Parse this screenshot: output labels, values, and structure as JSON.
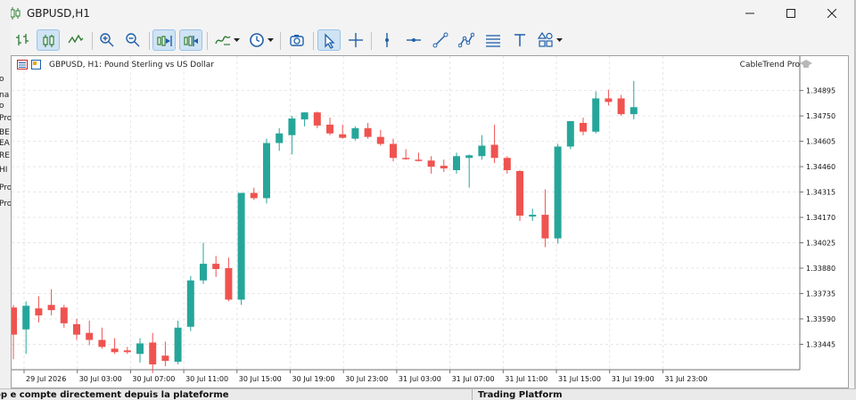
{
  "window": {
    "title": "GBPUSD,H1"
  },
  "toolbar": {
    "icons": [
      "bar-chart-icon",
      "candlestick-icon",
      "line-chart-icon",
      "zoom-in-icon",
      "zoom-out-icon",
      "autoscroll-icon",
      "chart-shift-icon",
      "indicators-icon",
      "timeframes-icon",
      "screenshot-icon",
      "cursor-icon",
      "crosshair-icon",
      "vertical-line-icon",
      "horizontal-line-icon",
      "trendline-icon",
      "objects-icon",
      "channels-icon",
      "text-icon",
      "shapes-icon"
    ]
  },
  "chart": {
    "header": "GBPUSD, H1:  Pound Sterling vs US Dollar",
    "expert_label": "CableTrend Pro",
    "bull_color": "#26a69a",
    "bear_color": "#ef5350",
    "grid_color": "#e6e6e6"
  },
  "chart_data": {
    "type": "candlestick",
    "symbol": "GBPUSD",
    "timeframe": "H1",
    "y_ticks": [
      "1.34895",
      "1.34750",
      "1.34605",
      "1.34460",
      "1.34315",
      "1.34170",
      "1.34025",
      "1.33880",
      "1.33735",
      "1.33590",
      "1.33445"
    ],
    "x_ticks": [
      "29 Jul 2026",
      "30 Jul 03:00",
      "30 Jul 07:00",
      "30 Jul 11:00",
      "30 Jul 15:00",
      "30 Jul 19:00",
      "30 Jul 23:00",
      "31 Jul 03:00",
      "31 Jul 07:00",
      "31 Jul 11:00",
      "31 Jul 15:00",
      "31 Jul 19:00",
      "31 Jul 23:00"
    ],
    "ylim": [
      1.3332,
      1.35
    ],
    "candles": [
      {
        "o": 1.33655,
        "h": 1.3367,
        "l": 1.3336,
        "c": 1.335
      },
      {
        "o": 1.3353,
        "h": 1.3369,
        "l": 1.3339,
        "c": 1.33665
      },
      {
        "o": 1.3365,
        "h": 1.3372,
        "l": 1.3357,
        "c": 1.3361
      },
      {
        "o": 1.3367,
        "h": 1.3376,
        "l": 1.3361,
        "c": 1.3364
      },
      {
        "o": 1.33655,
        "h": 1.3367,
        "l": 1.3354,
        "c": 1.33565
      },
      {
        "o": 1.3356,
        "h": 1.3359,
        "l": 1.3347,
        "c": 1.335
      },
      {
        "o": 1.3351,
        "h": 1.3358,
        "l": 1.3344,
        "c": 1.3347
      },
      {
        "o": 1.3347,
        "h": 1.3354,
        "l": 1.3342,
        "c": 1.3343
      },
      {
        "o": 1.3342,
        "h": 1.3348,
        "l": 1.3339,
        "c": 1.334
      },
      {
        "o": 1.3341,
        "h": 1.3343,
        "l": 1.3339,
        "c": 1.334
      },
      {
        "o": 1.3339,
        "h": 1.3348,
        "l": 1.3334,
        "c": 1.3345
      },
      {
        "o": 1.33455,
        "h": 1.3351,
        "l": 1.3328,
        "c": 1.3333
      },
      {
        "o": 1.3338,
        "h": 1.3346,
        "l": 1.3332,
        "c": 1.3335
      },
      {
        "o": 1.33345,
        "h": 1.3358,
        "l": 1.3333,
        "c": 1.3354
      },
      {
        "o": 1.33545,
        "h": 1.33835,
        "l": 1.3352,
        "c": 1.3381
      },
      {
        "o": 1.3381,
        "h": 1.34025,
        "l": 1.3379,
        "c": 1.33905
      },
      {
        "o": 1.33905,
        "h": 1.3395,
        "l": 1.3383,
        "c": 1.33875
      },
      {
        "o": 1.3388,
        "h": 1.3394,
        "l": 1.3369,
        "c": 1.337
      },
      {
        "o": 1.337,
        "h": 1.34005,
        "l": 1.3367,
        "c": 1.3431
      },
      {
        "o": 1.3431,
        "h": 1.3434,
        "l": 1.3427,
        "c": 1.3428
      },
      {
        "o": 1.3428,
        "h": 1.3462,
        "l": 1.3425,
        "c": 1.34595
      },
      {
        "o": 1.34595,
        "h": 1.3468,
        "l": 1.3455,
        "c": 1.3465
      },
      {
        "o": 1.3464,
        "h": 1.3475,
        "l": 1.3453,
        "c": 1.34735
      },
      {
        "o": 1.3473,
        "h": 1.3477,
        "l": 1.3469,
        "c": 1.3477
      },
      {
        "o": 1.3477,
        "h": 1.34775,
        "l": 1.3468,
        "c": 1.34695
      },
      {
        "o": 1.347,
        "h": 1.3474,
        "l": 1.3464,
        "c": 1.3465
      },
      {
        "o": 1.34645,
        "h": 1.347,
        "l": 1.3462,
        "c": 1.34625
      },
      {
        "o": 1.3462,
        "h": 1.3469,
        "l": 1.3461,
        "c": 1.3468
      },
      {
        "o": 1.3468,
        "h": 1.3471,
        "l": 1.3462,
        "c": 1.3463
      },
      {
        "o": 1.3463,
        "h": 1.3467,
        "l": 1.3458,
        "c": 1.3459
      },
      {
        "o": 1.3459,
        "h": 1.3462,
        "l": 1.3449,
        "c": 1.3451
      },
      {
        "o": 1.3451,
        "h": 1.3456,
        "l": 1.345,
        "c": 1.34505
      },
      {
        "o": 1.345,
        "h": 1.3454,
        "l": 1.3449,
        "c": 1.34495
      },
      {
        "o": 1.34495,
        "h": 1.3452,
        "l": 1.3442,
        "c": 1.3446
      },
      {
        "o": 1.34465,
        "h": 1.345,
        "l": 1.3443,
        "c": 1.3445
      },
      {
        "o": 1.3444,
        "h": 1.3454,
        "l": 1.3442,
        "c": 1.3452
      },
      {
        "o": 1.3451,
        "h": 1.3453,
        "l": 1.3434,
        "c": 1.34525
      },
      {
        "o": 1.3452,
        "h": 1.3464,
        "l": 1.345,
        "c": 1.3458
      },
      {
        "o": 1.34585,
        "h": 1.347,
        "l": 1.3448,
        "c": 1.3451
      },
      {
        "o": 1.3451,
        "h": 1.3452,
        "l": 1.3442,
        "c": 1.3444
      },
      {
        "o": 1.34435,
        "h": 1.3444,
        "l": 1.3415,
        "c": 1.3418
      },
      {
        "o": 1.34175,
        "h": 1.3422,
        "l": 1.3415,
        "c": 1.34185
      },
      {
        "o": 1.34185,
        "h": 1.3433,
        "l": 1.34,
        "c": 1.3405
      },
      {
        "o": 1.3405,
        "h": 1.3459,
        "l": 1.3402,
        "c": 1.34575
      },
      {
        "o": 1.34575,
        "h": 1.3472,
        "l": 1.3456,
        "c": 1.3472
      },
      {
        "o": 1.3471,
        "h": 1.3474,
        "l": 1.3464,
        "c": 1.3466
      },
      {
        "o": 1.3466,
        "h": 1.3489,
        "l": 1.3465,
        "c": 1.3485
      },
      {
        "o": 1.3485,
        "h": 1.349,
        "l": 1.3481,
        "c": 1.3483
      },
      {
        "o": 1.3485,
        "h": 1.3487,
        "l": 1.3475,
        "c": 1.3476
      },
      {
        "o": 1.3476,
        "h": 1.3495,
        "l": 1.3473,
        "c": 1.348
      }
    ]
  },
  "left_strip": [
    "o",
    "na",
    "o",
    "Pro",
    "BE",
    "EA",
    "RE",
    "HI",
    "Pro",
    "Pro"
  ],
  "bottom": {
    "left_text": "op  e compte directement depuis la plateforme",
    "right_text": "Trading Platform"
  }
}
